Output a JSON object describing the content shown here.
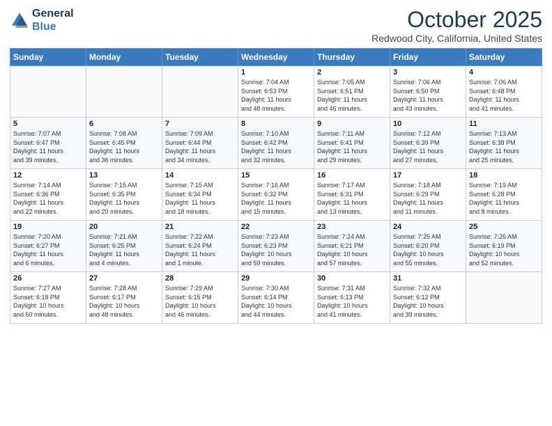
{
  "logo": {
    "line1": "General",
    "line2": "Blue"
  },
  "title": "October 2025",
  "location": "Redwood City, California, United States",
  "headers": [
    "Sunday",
    "Monday",
    "Tuesday",
    "Wednesday",
    "Thursday",
    "Friday",
    "Saturday"
  ],
  "weeks": [
    [
      {
        "day": "",
        "info": ""
      },
      {
        "day": "",
        "info": ""
      },
      {
        "day": "",
        "info": ""
      },
      {
        "day": "1",
        "info": "Sunrise: 7:04 AM\nSunset: 6:53 PM\nDaylight: 11 hours\nand 48 minutes."
      },
      {
        "day": "2",
        "info": "Sunrise: 7:05 AM\nSunset: 6:51 PM\nDaylight: 11 hours\nand 46 minutes."
      },
      {
        "day": "3",
        "info": "Sunrise: 7:06 AM\nSunset: 6:50 PM\nDaylight: 11 hours\nand 43 minutes."
      },
      {
        "day": "4",
        "info": "Sunrise: 7:06 AM\nSunset: 6:48 PM\nDaylight: 11 hours\nand 41 minutes."
      }
    ],
    [
      {
        "day": "5",
        "info": "Sunrise: 7:07 AM\nSunset: 6:47 PM\nDaylight: 11 hours\nand 39 minutes."
      },
      {
        "day": "6",
        "info": "Sunrise: 7:08 AM\nSunset: 6:45 PM\nDaylight: 11 hours\nand 36 minutes."
      },
      {
        "day": "7",
        "info": "Sunrise: 7:09 AM\nSunset: 6:44 PM\nDaylight: 11 hours\nand 34 minutes."
      },
      {
        "day": "8",
        "info": "Sunrise: 7:10 AM\nSunset: 6:42 PM\nDaylight: 11 hours\nand 32 minutes."
      },
      {
        "day": "9",
        "info": "Sunrise: 7:11 AM\nSunset: 6:41 PM\nDaylight: 11 hours\nand 29 minutes."
      },
      {
        "day": "10",
        "info": "Sunrise: 7:12 AM\nSunset: 6:39 PM\nDaylight: 11 hours\nand 27 minutes."
      },
      {
        "day": "11",
        "info": "Sunrise: 7:13 AM\nSunset: 6:38 PM\nDaylight: 11 hours\nand 25 minutes."
      }
    ],
    [
      {
        "day": "12",
        "info": "Sunrise: 7:14 AM\nSunset: 6:36 PM\nDaylight: 11 hours\nand 22 minutes."
      },
      {
        "day": "13",
        "info": "Sunrise: 7:15 AM\nSunset: 6:35 PM\nDaylight: 11 hours\nand 20 minutes."
      },
      {
        "day": "14",
        "info": "Sunrise: 7:15 AM\nSunset: 6:34 PM\nDaylight: 11 hours\nand 18 minutes."
      },
      {
        "day": "15",
        "info": "Sunrise: 7:16 AM\nSunset: 6:32 PM\nDaylight: 11 hours\nand 15 minutes."
      },
      {
        "day": "16",
        "info": "Sunrise: 7:17 AM\nSunset: 6:31 PM\nDaylight: 11 hours\nand 13 minutes."
      },
      {
        "day": "17",
        "info": "Sunrise: 7:18 AM\nSunset: 6:29 PM\nDaylight: 11 hours\nand 11 minutes."
      },
      {
        "day": "18",
        "info": "Sunrise: 7:19 AM\nSunset: 6:28 PM\nDaylight: 11 hours\nand 8 minutes."
      }
    ],
    [
      {
        "day": "19",
        "info": "Sunrise: 7:20 AM\nSunset: 6:27 PM\nDaylight: 11 hours\nand 6 minutes."
      },
      {
        "day": "20",
        "info": "Sunrise: 7:21 AM\nSunset: 6:25 PM\nDaylight: 11 hours\nand 4 minutes."
      },
      {
        "day": "21",
        "info": "Sunrise: 7:22 AM\nSunset: 6:24 PM\nDaylight: 11 hours\nand 1 minute."
      },
      {
        "day": "22",
        "info": "Sunrise: 7:23 AM\nSunset: 6:23 PM\nDaylight: 10 hours\nand 59 minutes."
      },
      {
        "day": "23",
        "info": "Sunrise: 7:24 AM\nSunset: 6:21 PM\nDaylight: 10 hours\nand 57 minutes."
      },
      {
        "day": "24",
        "info": "Sunrise: 7:25 AM\nSunset: 6:20 PM\nDaylight: 10 hours\nand 55 minutes."
      },
      {
        "day": "25",
        "info": "Sunrise: 7:26 AM\nSunset: 6:19 PM\nDaylight: 10 hours\nand 52 minutes."
      }
    ],
    [
      {
        "day": "26",
        "info": "Sunrise: 7:27 AM\nSunset: 6:18 PM\nDaylight: 10 hours\nand 50 minutes."
      },
      {
        "day": "27",
        "info": "Sunrise: 7:28 AM\nSunset: 6:17 PM\nDaylight: 10 hours\nand 48 minutes."
      },
      {
        "day": "28",
        "info": "Sunrise: 7:29 AM\nSunset: 6:15 PM\nDaylight: 10 hours\nand 46 minutes."
      },
      {
        "day": "29",
        "info": "Sunrise: 7:30 AM\nSunset: 6:14 PM\nDaylight: 10 hours\nand 44 minutes."
      },
      {
        "day": "30",
        "info": "Sunrise: 7:31 AM\nSunset: 6:13 PM\nDaylight: 10 hours\nand 41 minutes."
      },
      {
        "day": "31",
        "info": "Sunrise: 7:32 AM\nSunset: 6:12 PM\nDaylight: 10 hours\nand 39 minutes."
      },
      {
        "day": "",
        "info": ""
      }
    ]
  ]
}
